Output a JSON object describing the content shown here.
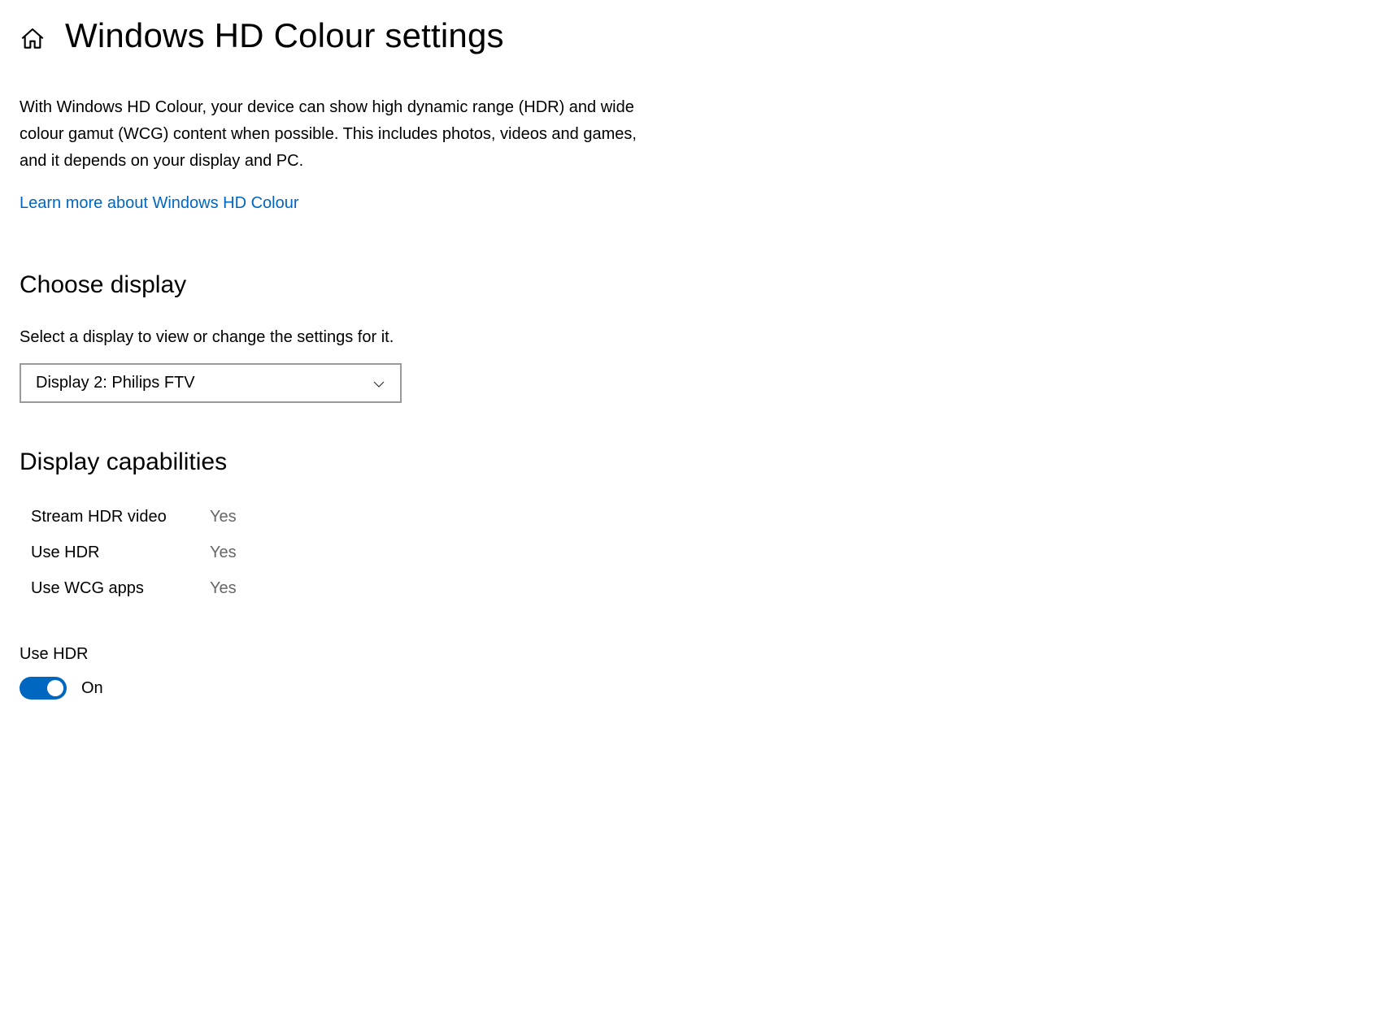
{
  "header": {
    "title": "Windows HD Colour settings"
  },
  "description": "With Windows HD Colour, your device can show high dynamic range (HDR) and wide colour gamut (WCG) content when possible. This includes photos, videos and games, and it depends on your display and PC.",
  "learn_more_label": "Learn more about Windows HD Colour",
  "choose_display": {
    "heading": "Choose display",
    "subtext": "Select a display to view or change the settings for it.",
    "selected": "Display 2: Philips FTV"
  },
  "capabilities": {
    "heading": "Display capabilities",
    "rows": [
      {
        "label": "Stream HDR video",
        "value": "Yes"
      },
      {
        "label": "Use HDR",
        "value": "Yes"
      },
      {
        "label": "Use WCG apps",
        "value": "Yes"
      }
    ]
  },
  "use_hdr": {
    "label": "Use HDR",
    "state": "On"
  }
}
